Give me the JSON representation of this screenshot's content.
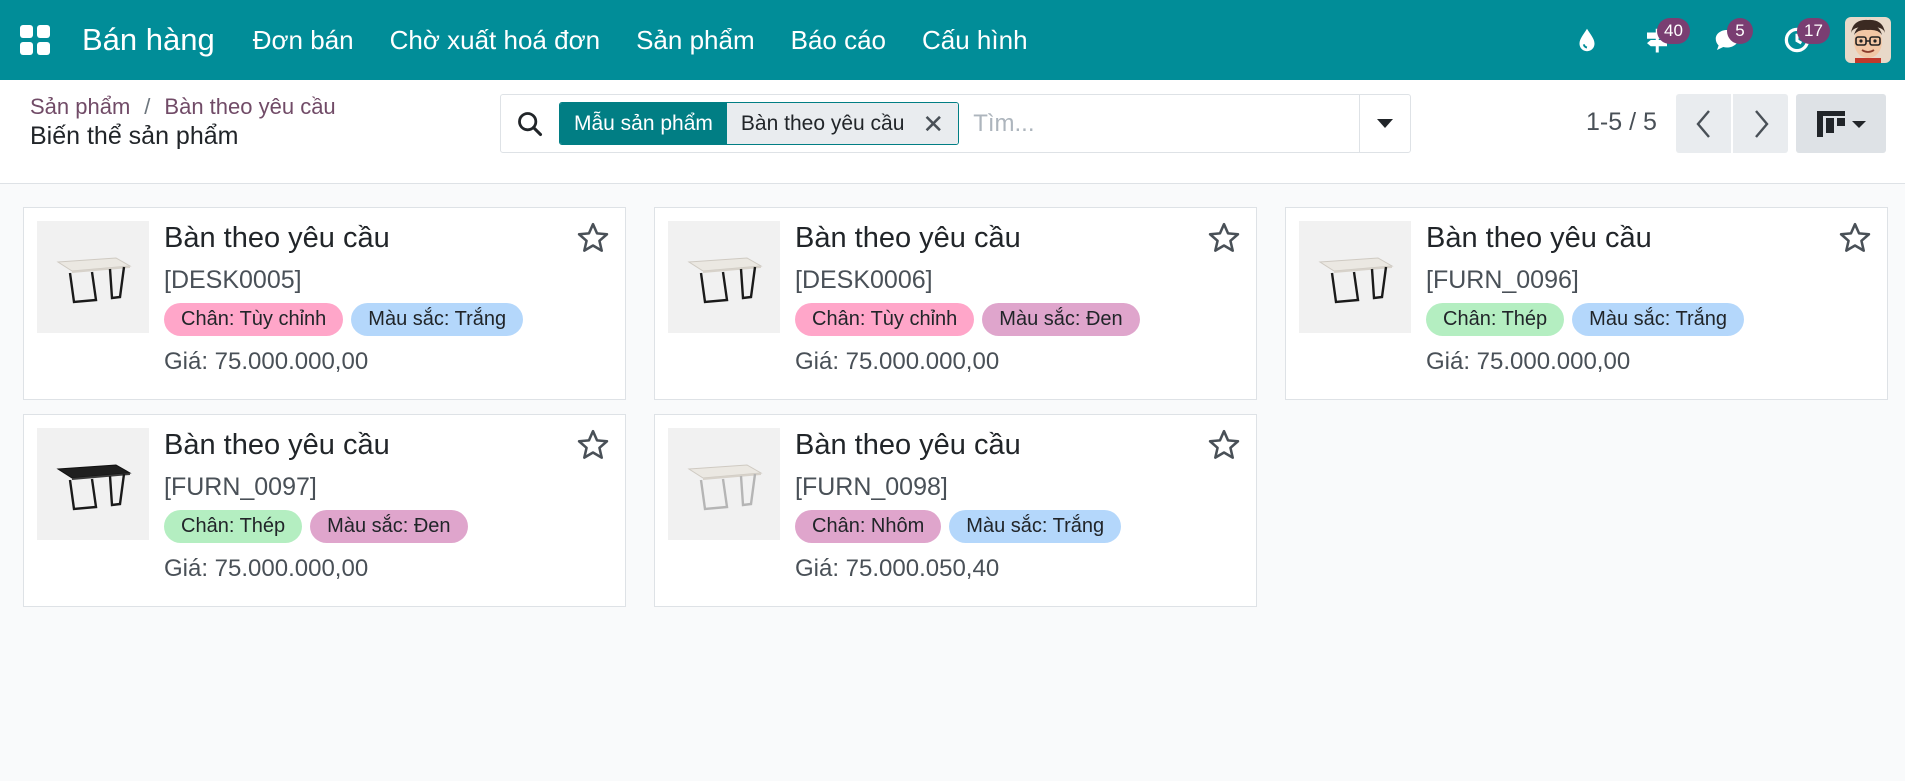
{
  "app": {
    "brand": "Bán hàng",
    "menu": [
      "Đơn bán",
      "Chờ xuất hoá đơn",
      "Sản phẩm",
      "Báo cáo",
      "Cấu hình"
    ],
    "badges": {
      "activities": "40",
      "messages": "5",
      "clock": "17"
    }
  },
  "breadcrumb": {
    "root": "Sản phẩm",
    "sep": "/",
    "current": "Bàn theo yêu cầu",
    "subtitle": "Biến thể sản phẩm"
  },
  "search": {
    "facet_label": "Mẫu sản phẩm",
    "facet_value": "Bàn theo yêu cầu",
    "facet_close": "✕",
    "placeholder": "Tìm..."
  },
  "pager": {
    "text": "1-5 / 5"
  },
  "tag_colors": {
    "pink": "#ffa6c9",
    "mauve": "#dfa5cc",
    "blue": "#b4d7fb",
    "green": "#b4eec1"
  },
  "cards": [
    {
      "title": "Bàn theo yêu cầu",
      "code": "[DESK0005]",
      "tags": [
        {
          "label": "Chân: Tùy chỉnh",
          "color": "pink"
        },
        {
          "label": "Màu sắc: Trắng",
          "color": "blue"
        }
      ],
      "price": "Giá: 75.000.000,00",
      "top_color": "white"
    },
    {
      "title": "Bàn theo yêu cầu",
      "code": "[DESK0006]",
      "tags": [
        {
          "label": "Chân: Tùy chỉnh",
          "color": "pink"
        },
        {
          "label": "Màu sắc: Đen",
          "color": "mauve"
        }
      ],
      "price": "Giá: 75.000.000,00",
      "top_color": "white"
    },
    {
      "title": "Bàn theo yêu cầu",
      "code": "[FURN_0096]",
      "tags": [
        {
          "label": "Chân: Thép",
          "color": "green"
        },
        {
          "label": "Màu sắc: Trắng",
          "color": "blue"
        }
      ],
      "price": "Giá: 75.000.000,00",
      "top_color": "white"
    },
    {
      "title": "Bàn theo yêu cầu",
      "code": "[FURN_0097]",
      "tags": [
        {
          "label": "Chân: Thép",
          "color": "green"
        },
        {
          "label": "Màu sắc: Đen",
          "color": "mauve"
        }
      ],
      "price": "Giá: 75.000.000,00",
      "top_color": "black"
    },
    {
      "title": "Bàn theo yêu cầu",
      "code": "[FURN_0098]",
      "tags": [
        {
          "label": "Chân: Nhôm",
          "color": "mauve"
        },
        {
          "label": "Màu sắc: Trắng",
          "color": "blue"
        }
      ],
      "price": "Giá: 75.000.050,40",
      "top_color": "white"
    }
  ]
}
